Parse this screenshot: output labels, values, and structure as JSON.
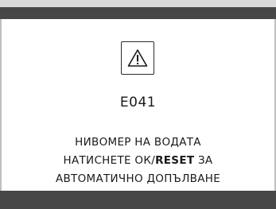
{
  "header_bar": {
    "color": "#474747"
  },
  "footer_bar": {
    "color": "#474747"
  },
  "alert": {
    "icon": "warning-triangle-icon",
    "code": "E041",
    "line1": "НИВОМЕР НА ВОДАТА",
    "line2_prefix": "НАТИСНЕТЕ ОК/",
    "line2_key": "RESET",
    "line2_suffix": " ЗА",
    "line3": "АВТОМАТИЧНО ДОПЪЛВАНЕ"
  }
}
